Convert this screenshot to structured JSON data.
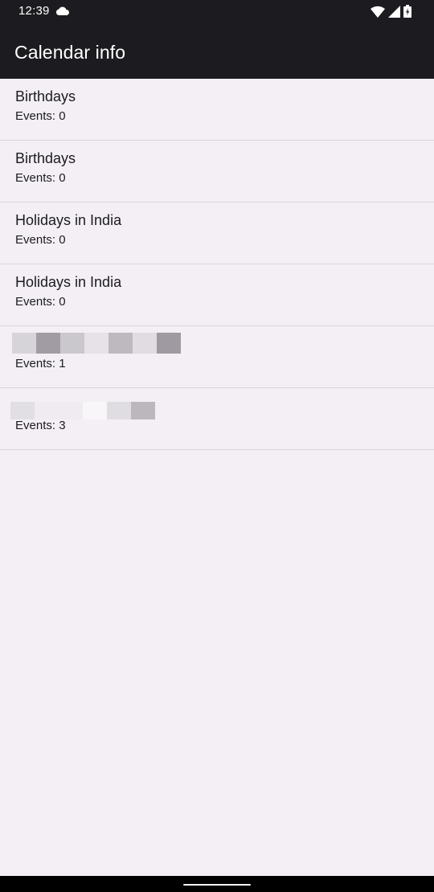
{
  "status_bar": {
    "time": "12:39",
    "icons": [
      "cloud-icon",
      "wifi-icon",
      "signal-icon",
      "battery-icon"
    ]
  },
  "app_bar": {
    "title": "Calendar info"
  },
  "calendars": [
    {
      "title": "Birthdays",
      "events": "Events: 0"
    },
    {
      "title": "Birthdays",
      "events": "Events: 0"
    },
    {
      "title": "Holidays in India",
      "events": "Events: 0"
    },
    {
      "title": "Holidays in India",
      "events": "Events: 0"
    },
    {
      "title": "",
      "events": "Events: 1",
      "title_redacted": true
    },
    {
      "title": "",
      "events": "Events: 3",
      "title_redacted": true
    }
  ],
  "colors": {
    "bar_background": "#1c1b1f",
    "page_background": "#f3eff4",
    "divider": "#d9d6da",
    "text": "#1c1b1f"
  }
}
